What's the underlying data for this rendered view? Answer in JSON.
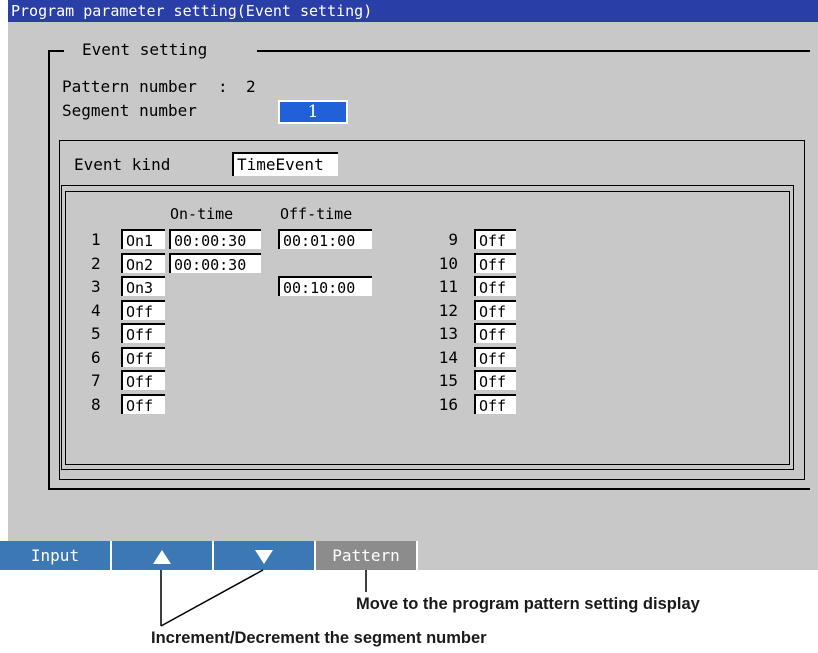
{
  "title": "Program parameter setting(Event setting)",
  "section_title": "Event setting",
  "pattern": {
    "label": "Pattern number",
    "colon": ":",
    "value": "2"
  },
  "segment": {
    "label": "Segment number",
    "value": "1"
  },
  "event_kind": {
    "label": "Event kind",
    "value": "TimeEvent"
  },
  "headers": {
    "on_time": "On-time",
    "off_time": "Off-time"
  },
  "events": [
    {
      "num": "1",
      "state": "On1",
      "on_time": "00:00:30",
      "off_time": "00:01:00"
    },
    {
      "num": "2",
      "state": "On2",
      "on_time": "00:00:30",
      "off_time": ""
    },
    {
      "num": "3",
      "state": "On3",
      "on_time": "",
      "off_time": "00:10:00"
    },
    {
      "num": "4",
      "state": "Off",
      "on_time": "",
      "off_time": ""
    },
    {
      "num": "5",
      "state": "Off",
      "on_time": "",
      "off_time": ""
    },
    {
      "num": "6",
      "state": "Off",
      "on_time": "",
      "off_time": ""
    },
    {
      "num": "7",
      "state": "Off",
      "on_time": "",
      "off_time": ""
    },
    {
      "num": "8",
      "state": "Off",
      "on_time": "",
      "off_time": ""
    },
    {
      "num": "9",
      "state": "Off"
    },
    {
      "num": "10",
      "state": "Off"
    },
    {
      "num": "11",
      "state": "Off"
    },
    {
      "num": "12",
      "state": "Off"
    },
    {
      "num": "13",
      "state": "Off"
    },
    {
      "num": "14",
      "state": "Off"
    },
    {
      "num": "15",
      "state": "Off"
    },
    {
      "num": "16",
      "state": "Off"
    }
  ],
  "softkeys": {
    "input": "Input",
    "up_icon": "triangle-up-icon",
    "down_icon": "triangle-down-icon",
    "pattern": "Pattern"
  },
  "annotations": {
    "pattern_note": "Move to the program pattern setting display",
    "arrow_note": "Increment/Decrement the segment number"
  },
  "colors": {
    "title_bar": "#2a3ea8",
    "screen_bg": "#c8c8c8",
    "selected_field": "#2060d8",
    "softkey": "#3c78b4",
    "softkey_pattern": "#8c8c8c"
  }
}
